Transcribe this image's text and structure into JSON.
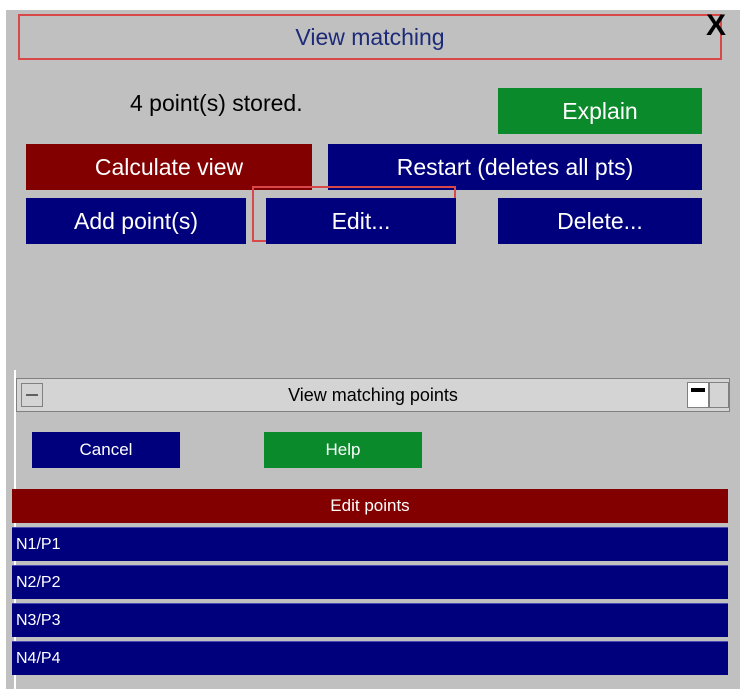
{
  "window": {
    "title": "View matching",
    "close_glyph": "X"
  },
  "status_text": "4 point(s) stored.",
  "buttons": {
    "explain": "Explain",
    "calculate_view": "Calculate view",
    "restart": "Restart (deletes all pts)",
    "add_points": "Add point(s)",
    "edit": "Edit...",
    "delete": "Delete..."
  },
  "subwindow": {
    "title": "View matching points",
    "cancel": "Cancel",
    "help": "Help",
    "list_header": "Edit points",
    "rows": [
      "N1/P1",
      "N2/P2",
      "N3/P3",
      "N4/P4"
    ]
  },
  "colors": {
    "navy": "#00007c",
    "green": "#0a8a2a",
    "maroon": "#820000",
    "highlight_border": "#d84848"
  }
}
